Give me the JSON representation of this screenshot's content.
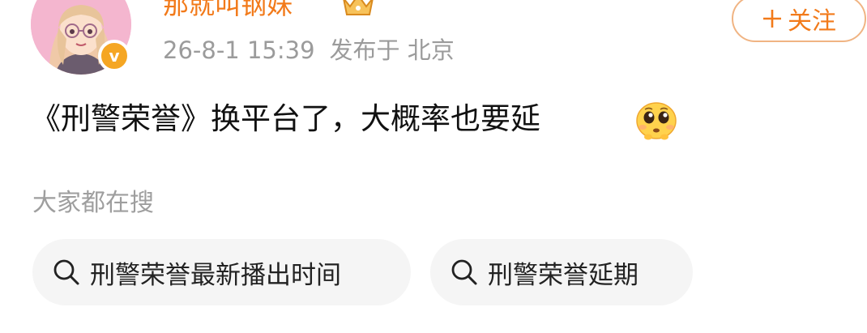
{
  "post": {
    "username": "那就叫钢妹",
    "timestamp": "26-8-1 15:39",
    "location_prefix": "发布于",
    "location": "北京",
    "follow_button": {
      "icon": "plus",
      "label": "关注"
    },
    "verified_badge": "v",
    "content": "《刑警荣誉》换平台了，大概率也要延",
    "content_emoji": "pleading-face-emoji"
  },
  "related_search": {
    "heading": "大家都在搜",
    "items": [
      {
        "icon": "search-icon",
        "label": "刑警荣誉最新播出时间"
      },
      {
        "icon": "search-icon",
        "label": "刑警荣誉延期"
      }
    ]
  },
  "colors": {
    "accent": "#f27a1a",
    "badge": "#f5a623",
    "muted_text": "#9b9b9b",
    "pill_bg": "#f5f5f5"
  }
}
